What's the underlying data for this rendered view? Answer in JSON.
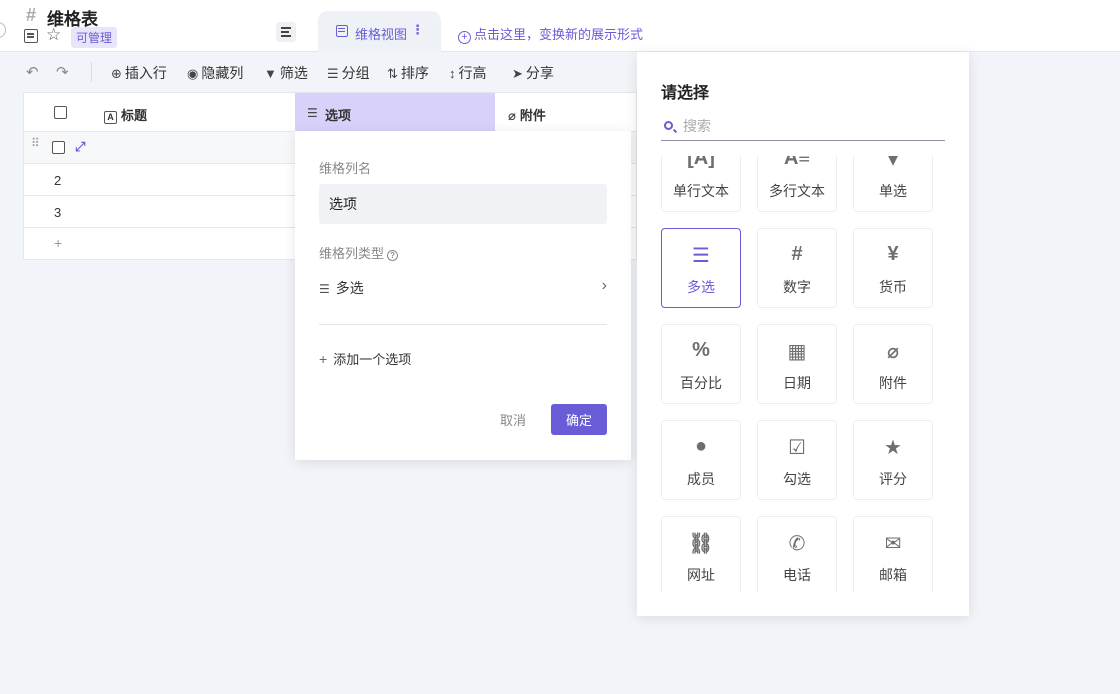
{
  "header": {
    "hash": "#",
    "title": "维格表",
    "permission": "可管理",
    "view_tab_label": "维格视图",
    "add_view_text": "点击这里，变换新的展示形式"
  },
  "toolbar": {
    "insert_row": "插入行",
    "hide_columns": "隐藏列",
    "filter": "筛选",
    "group": "分组",
    "sort": "排序",
    "row_height": "行高",
    "share": "分享"
  },
  "table": {
    "columns": [
      "标题",
      "选项",
      "附件"
    ],
    "rows": [
      "2",
      "3"
    ],
    "add_row": "+"
  },
  "column_editor": {
    "name_label": "维格列名",
    "name_value": "选项",
    "type_label": "维格列类型",
    "type_value": "多选",
    "add_option": "添加一个选项",
    "cancel": "取消",
    "confirm": "确定"
  },
  "type_picker": {
    "title": "请选择",
    "search_placeholder": "搜索",
    "types": [
      "单行文本",
      "多行文本",
      "单选",
      "多选",
      "数字",
      "货币",
      "百分比",
      "日期",
      "附件",
      "成员",
      "勾选",
      "评分",
      "网址",
      "电话",
      "邮箱"
    ],
    "selected": "多选"
  },
  "colors": {
    "accent": "#6a5cd6",
    "selected_column_bg": "#d8d2fa"
  }
}
